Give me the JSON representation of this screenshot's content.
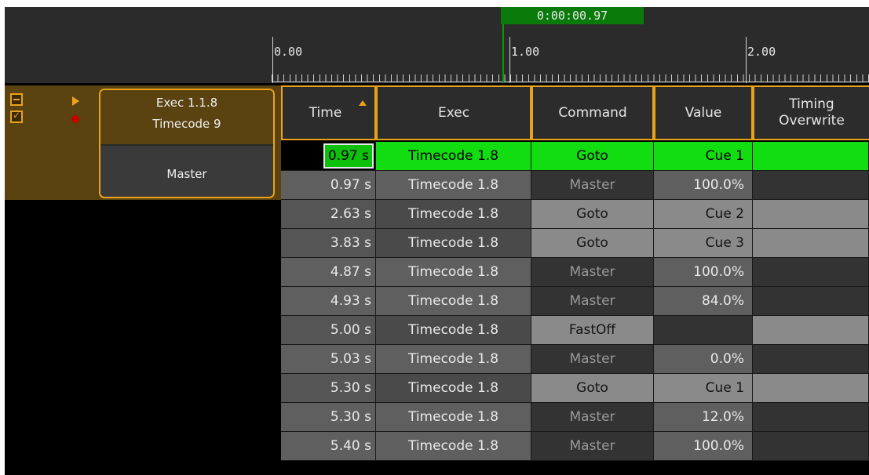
{
  "timeline": {
    "playhead_time": "0:00:00.97",
    "ruler_labels": [
      "0.00",
      "1.00",
      "2.00"
    ]
  },
  "track": {
    "exec_title": "Exec 1.1.8",
    "exec_subtitle": "Timecode 9",
    "exec_master": "Master",
    "checkbox_mark": "✓"
  },
  "table": {
    "headers": {
      "time": "Time",
      "exec": "Exec",
      "command": "Command",
      "value": "Value",
      "timing_line1": "Timing",
      "timing_line2": "Overwrite"
    },
    "rows": [
      {
        "time": "0.97 s",
        "exec": "Timecode 1.8",
        "command": "Goto",
        "value": "Cue 1"
      },
      {
        "time": "0.97 s",
        "exec": "Timecode 1.8",
        "command": "Master",
        "value": "100.0%"
      },
      {
        "time": "2.63 s",
        "exec": "Timecode 1.8",
        "command": "Goto",
        "value": "Cue 2"
      },
      {
        "time": "3.83 s",
        "exec": "Timecode 1.8",
        "command": "Goto",
        "value": "Cue 3"
      },
      {
        "time": "4.87 s",
        "exec": "Timecode 1.8",
        "command": "Master",
        "value": "100.0%"
      },
      {
        "time": "4.93 s",
        "exec": "Timecode 1.8",
        "command": "Master",
        "value": "84.0%"
      },
      {
        "time": "5.00 s",
        "exec": "Timecode 1.8",
        "command": "FastOff",
        "value": ""
      },
      {
        "time": "5.03 s",
        "exec": "Timecode 1.8",
        "command": "Master",
        "value": "0.0%"
      },
      {
        "time": "5.30 s",
        "exec": "Timecode 1.8",
        "command": "Goto",
        "value": "Cue 1"
      },
      {
        "time": "5.30 s",
        "exec": "Timecode 1.8",
        "command": "Master",
        "value": "12.0%"
      },
      {
        "time": "5.40 s",
        "exec": "Timecode 1.8",
        "command": "Master",
        "value": "100.0%"
      }
    ]
  },
  "colors": {
    "accent": "#e8a21c",
    "active_row": "#11dd11",
    "playhead": "#0a7a0a"
  }
}
